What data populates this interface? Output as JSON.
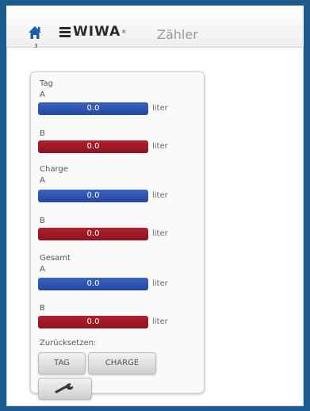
{
  "header": {
    "home_badge": "3",
    "logo_text": "WIWA",
    "logo_reg": "®",
    "title": "Zähler"
  },
  "panel": {
    "unit": "liter",
    "sections": [
      {
        "label": "Tag",
        "a_label": "A",
        "a_value": "0.0",
        "b_label": "B",
        "b_value": "0.0"
      },
      {
        "label": "Charge",
        "a_label": "A",
        "a_value": "0.0",
        "b_label": "B",
        "b_value": "0.0"
      },
      {
        "label": "Gesamt",
        "a_label": "A",
        "a_value": "0.0",
        "b_label": "B",
        "b_value": "0.0"
      }
    ],
    "reset_label": "Zurücksetzen:",
    "buttons": {
      "tag": "TAG",
      "charge": "CHARGE"
    }
  },
  "colors": {
    "series_a": "#2b4fb0",
    "series_b": "#a01a28",
    "border": "#1d5b8f"
  },
  "icons": {
    "home": "home-icon",
    "tools": "wrench-icon"
  }
}
